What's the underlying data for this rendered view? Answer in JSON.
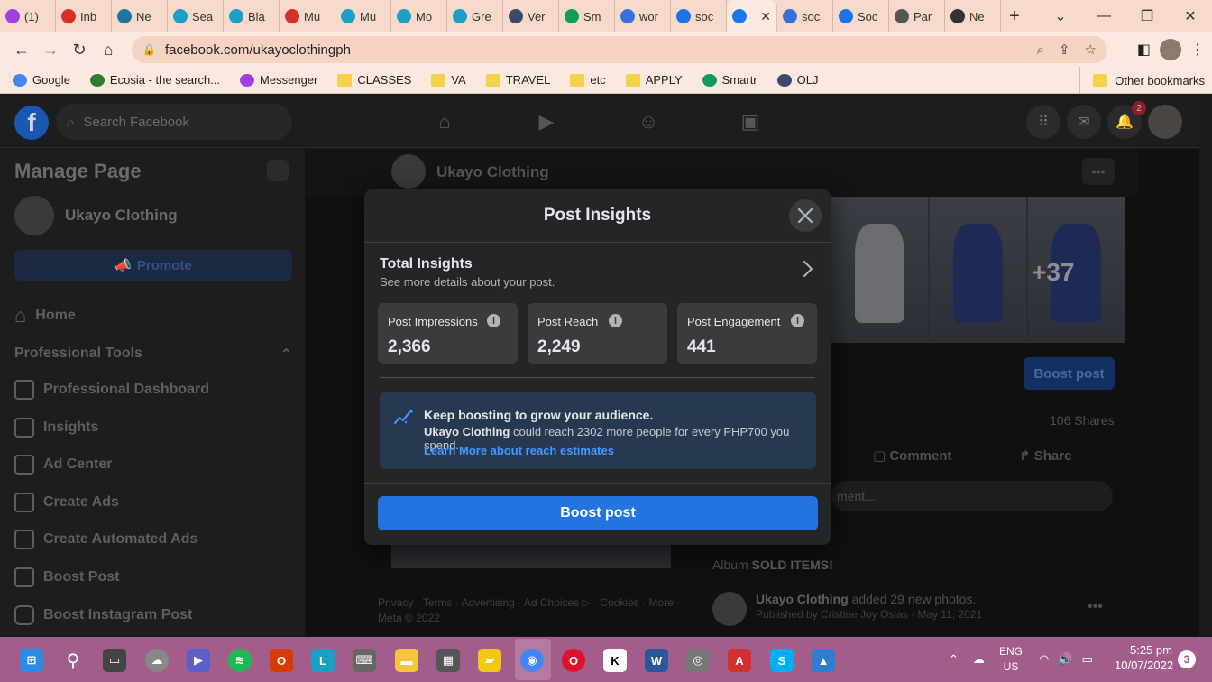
{
  "browser": {
    "tabs": [
      {
        "label": "(1)",
        "icon": "messenger-icon",
        "color": "#a040e0"
      },
      {
        "label": "Inb",
        "icon": "gmail-icon",
        "color": "#d93025"
      },
      {
        "label": "Ne",
        "icon": "wordpress-icon",
        "color": "#21759b"
      },
      {
        "label": "Sea",
        "icon": "canva-icon",
        "color": "#1aa0c7"
      },
      {
        "label": "Bla",
        "icon": "canva-icon",
        "color": "#1aa0c7"
      },
      {
        "label": "Mu",
        "icon": "gmail-icon",
        "color": "#d93025"
      },
      {
        "label": "Mu",
        "icon": "canva-icon",
        "color": "#1aa0c7"
      },
      {
        "label": "Mo",
        "icon": "canva-icon",
        "color": "#1aa0c7"
      },
      {
        "label": "Gre",
        "icon": "canva-icon",
        "color": "#1aa0c7"
      },
      {
        "label": "Ver",
        "icon": "globe-icon",
        "color": "#3b4a6b"
      },
      {
        "label": "Sm",
        "icon": "smartr-icon",
        "color": "#0f9d58"
      },
      {
        "label": "wor",
        "icon": "search-icon",
        "color": "#3b6fd8"
      },
      {
        "label": "soc",
        "icon": "bing-icon",
        "color": "#1a73e8"
      },
      {
        "label": "",
        "icon": "facebook-icon",
        "color": "#1877f2",
        "active": true
      },
      {
        "label": "soc",
        "icon": "search-icon",
        "color": "#3b6fd8"
      },
      {
        "label": "Soc",
        "icon": "info-icon",
        "color": "#1a73e8"
      },
      {
        "label": "Par",
        "icon": "pen-icon",
        "color": "#555555"
      },
      {
        "label": "Ne",
        "icon": "globe-icon",
        "color": "#333333"
      }
    ],
    "url": "facebook.com/ukayoclothingph",
    "bookmarks": [
      {
        "label": "Google",
        "icon": "google-icon"
      },
      {
        "label": "Ecosia - the search...",
        "icon": "ecosia-icon"
      },
      {
        "label": "Messenger",
        "icon": "messenger-icon"
      },
      {
        "label": "CLASSES",
        "icon": "folder-icon"
      },
      {
        "label": "VA",
        "icon": "folder-icon"
      },
      {
        "label": "TRAVEL",
        "icon": "folder-icon"
      },
      {
        "label": "etc",
        "icon": "folder-icon"
      },
      {
        "label": "APPLY",
        "icon": "folder-icon"
      },
      {
        "label": "Smartr",
        "icon": "smartr-icon"
      },
      {
        "label": "OLJ",
        "icon": "olj-icon"
      }
    ],
    "other_bookmarks": "Other bookmarks"
  },
  "facebook": {
    "search_placeholder": "Search Facebook",
    "notifications_count": "2",
    "sidebar": {
      "title": "Manage Page",
      "page_name": "Ukayo Clothing",
      "promote": "Promote",
      "home": "Home",
      "section": "Professional Tools",
      "items": [
        "Professional Dashboard",
        "Insights",
        "Ad Center",
        "Create Ads",
        "Create Automated Ads",
        "Boost Post",
        "Boost Instagram Post"
      ]
    },
    "page_header_name": "Ukayo Clothing",
    "photo_more": "+37",
    "boost_post": "Boost post",
    "shares": "106 Shares",
    "comment": "Comment",
    "share": "Share",
    "comment_placeholder": "ment...",
    "album_prefix": "Album",
    "album_name": "SOLD ITEMS!",
    "post2": {
      "name": "Ukayo Clothing",
      "action": "added 29 new photos.",
      "meta": "Published by Cristine Joy Osias · May 11, 2021 ·"
    },
    "footer": "Privacy · Terms · Advertising · Ad Choices ▷ · Cookies · More · Meta © 2022"
  },
  "modal": {
    "title": "Post Insights",
    "total_title": "Total Insights",
    "total_sub": "See more details about your post.",
    "metrics": [
      {
        "label": "Post Impressions",
        "value": "2,366"
      },
      {
        "label": "Post Reach",
        "value": "2,249"
      },
      {
        "label": "Post Engagement",
        "value": "441"
      }
    ],
    "tip_title": "Keep boosting to grow your audience.",
    "tip_page": "Ukayo Clothing",
    "tip_body": "could reach 2302 more people for every PHP700 you spend.",
    "tip_link": "Learn More about reach estimates",
    "boost_button": "Boost post"
  },
  "taskbar": {
    "lang": "ENG",
    "region": "US",
    "time": "5:25 pm",
    "date": "10/07/2022",
    "notifications": "3"
  }
}
